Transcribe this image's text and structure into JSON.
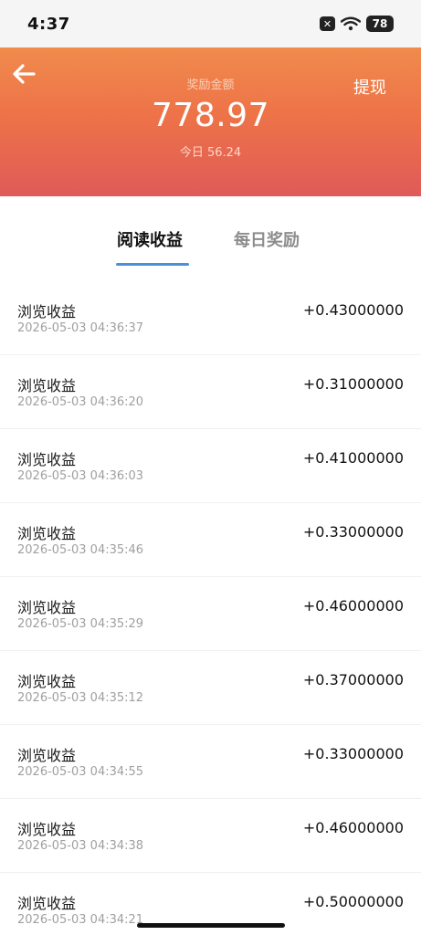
{
  "status_bar": {
    "time": "4:37",
    "battery": "78",
    "x_badge": "✕"
  },
  "header": {
    "back_icon": "arrow-left-icon",
    "withdraw_label": "提现",
    "reward_label": "奖励金额",
    "reward_amount": "778.97",
    "today_label": "今日 56.24",
    "colors": {
      "gradient_top": "#f08b4d",
      "gradient_bottom": "#df5a58"
    }
  },
  "tabs": [
    {
      "label": "阅读收益",
      "active": true
    },
    {
      "label": "每日奖励",
      "active": false
    }
  ],
  "accent_color": "#4a8fd8",
  "records": [
    {
      "title": "浏览收益",
      "time": "2026-05-03 04:36:37",
      "amount": "+0.43000000"
    },
    {
      "title": "浏览收益",
      "time": "2026-05-03 04:36:20",
      "amount": "+0.31000000"
    },
    {
      "title": "浏览收益",
      "time": "2026-05-03 04:36:03",
      "amount": "+0.41000000"
    },
    {
      "title": "浏览收益",
      "time": "2026-05-03 04:35:46",
      "amount": "+0.33000000"
    },
    {
      "title": "浏览收益",
      "time": "2026-05-03 04:35:29",
      "amount": "+0.46000000"
    },
    {
      "title": "浏览收益",
      "time": "2026-05-03 04:35:12",
      "amount": "+0.37000000"
    },
    {
      "title": "浏览收益",
      "time": "2026-05-03 04:34:55",
      "amount": "+0.33000000"
    },
    {
      "title": "浏览收益",
      "time": "2026-05-03 04:34:38",
      "amount": "+0.46000000"
    },
    {
      "title": "浏览收益",
      "time": "2026-05-03 04:34:21",
      "amount": "+0.50000000"
    }
  ]
}
